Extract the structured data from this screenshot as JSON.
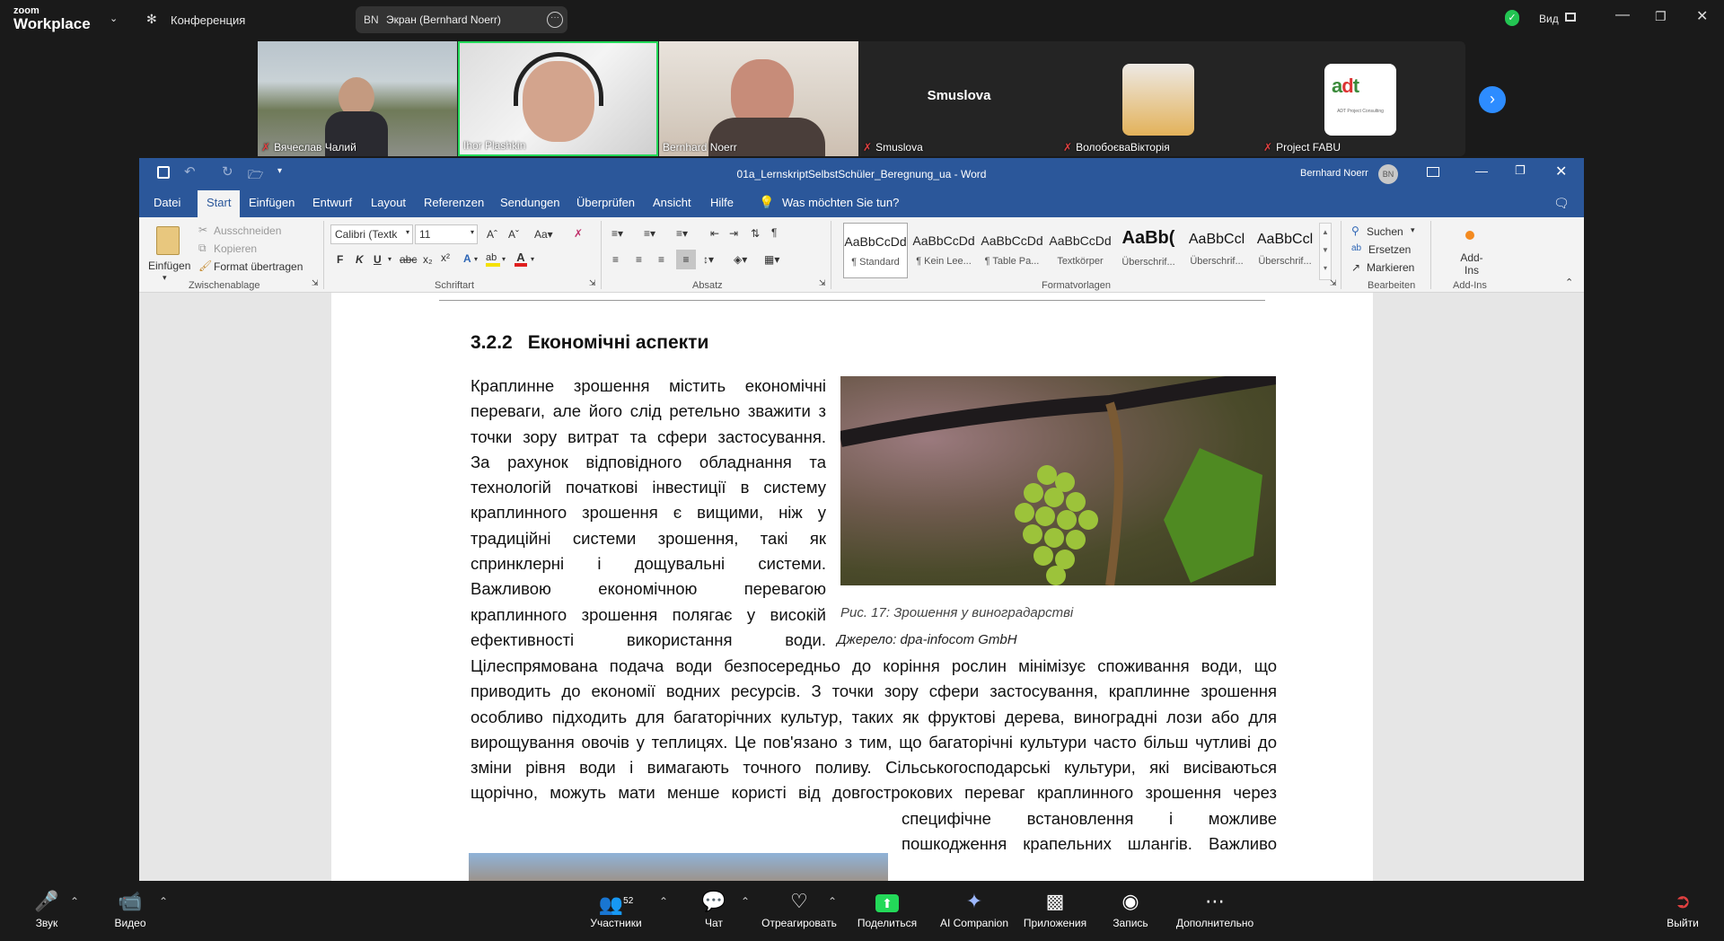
{
  "zoom": {
    "logo_line1": "zoom",
    "logo_line2": "Workplace",
    "meeting_label": "Конференция",
    "share_initials": "BN",
    "share_label": "Экран (Bernhard Noerr)",
    "view_label": "Вид",
    "colors": {
      "bg": "#1a1a1a",
      "accent": "#2d8cff",
      "share_green": "#23d959",
      "mic_off": "#e04040"
    }
  },
  "gallery": {
    "participants": [
      {
        "name": "Вячеслав Чалий",
        "muted": true,
        "video": "street"
      },
      {
        "name": "Ihor Plashkin",
        "muted": false,
        "video": "headset",
        "active_speaker": true
      },
      {
        "name": "Bernhard Noerr",
        "muted": false,
        "video": "office"
      },
      {
        "name": "Smuslova",
        "muted": true,
        "video": "none"
      },
      {
        "name": "ВолобоєваВікторія",
        "muted": true,
        "video": "avatar-woman"
      },
      {
        "name": "Project FABU",
        "muted": true,
        "video": "avatar-logo"
      }
    ],
    "next_icon": "chevron-right-icon",
    "logo_caption": "ADT Project Consulting"
  },
  "word": {
    "doc_title": "01a_LernskriptSelbstSchüler_Beregnung_ua  -  Word",
    "user_name": "Bernhard Noerr",
    "user_initials": "BN",
    "tabs": [
      "Datei",
      "Start",
      "Einfügen",
      "Entwurf",
      "Layout",
      "Referenzen",
      "Sendungen",
      "Überprüfen",
      "Ansicht",
      "Hilfe"
    ],
    "active_tab": "Start",
    "tell_me": "Was möchten Sie tun?",
    "clipboard": {
      "paste": "Einfügen",
      "cut": "Ausschneiden",
      "copy": "Kopieren",
      "format_painter": "Format übertragen",
      "group": "Zwischenablage"
    },
    "font": {
      "name": "Calibri (Textk",
      "size": "11",
      "group": "Schriftart"
    },
    "paragraph_group": "Absatz",
    "styles": {
      "items": [
        {
          "preview": "AaBbCcDd",
          "name": "¶ Standard"
        },
        {
          "preview": "AaBbCcDd",
          "name": "¶ Kein Lee..."
        },
        {
          "preview": "AaBbCcDd",
          "name": "¶ Table Pa..."
        },
        {
          "preview": "AaBbCcDd",
          "name": "Textkörper"
        },
        {
          "preview": "AaBb(",
          "name": "Überschrif..."
        },
        {
          "preview": "AaBbCcl",
          "name": "Überschrif..."
        },
        {
          "preview": "AaBbCcl",
          "name": "Überschrif..."
        }
      ],
      "group": "Formatvorlagen"
    },
    "editing": {
      "find": "Suchen",
      "replace": "Ersetzen",
      "select": "Markieren",
      "group": "Bearbeiten"
    },
    "addins": {
      "label": "Add-Ins",
      "group": "Add-Ins"
    }
  },
  "document": {
    "heading_num": "3.2.2",
    "heading_text": "Економічні аспекти",
    "float_lines": [
      "Краплинне зрошення містить економічні",
      "переваги, але його слід ретельно зважити з",
      "точки зору витрат та сфери застосування.",
      "За рахунок відповідного обладнання та",
      "технологій початкові інвестиції в систему",
      "краплинного зрошення є вищими, ніж у",
      "традиційні системи зрошення, такі як",
      "спринклерні і дощувальні системи.",
      "Важливою економічною перевагою",
      "краплинного зрошення полягає у високій",
      "ефективності використання води."
    ],
    "full_lines": [
      "Цілеспрямована подача води безпосередньо до коріння рослин мінімізує споживання води, що",
      "приводить до економії водних ресурсів.  З точки зору сфери застосування, краплинне зрошення",
      "особливо підходить для багаторічних культур, таких як фруктові дерева, виноградні лози або для",
      "вирощування овочів у теплицях. Це пов'язано з тим, що багаторічні культури часто більш чутливі до",
      "зміни рівня води і вимагають точного поливу. Сільськогосподарські культури, які висіваються",
      "щорічно, можуть мати менше користі від довгострокових переваг краплинного зрошення через"
    ],
    "bottom_lines": [
      "специфічне встановлення і можливе",
      "пошкодження крапельних шлангів.  Важливо"
    ],
    "figure_caption": "Рис. 17: Зрошення у виноградарстві",
    "figure_source": "Джерело: dpa-infocom GmbH"
  },
  "bottombar": {
    "audio": "Звук",
    "video": "Видео",
    "participants": "Участники",
    "participants_count": "52",
    "chat": "Чат",
    "react": "Отреагировать",
    "share": "Поделиться",
    "ai": "AI Companion",
    "apps": "Приложения",
    "record": "Запись",
    "more": "Дополнительно",
    "leave": "Выйти"
  }
}
